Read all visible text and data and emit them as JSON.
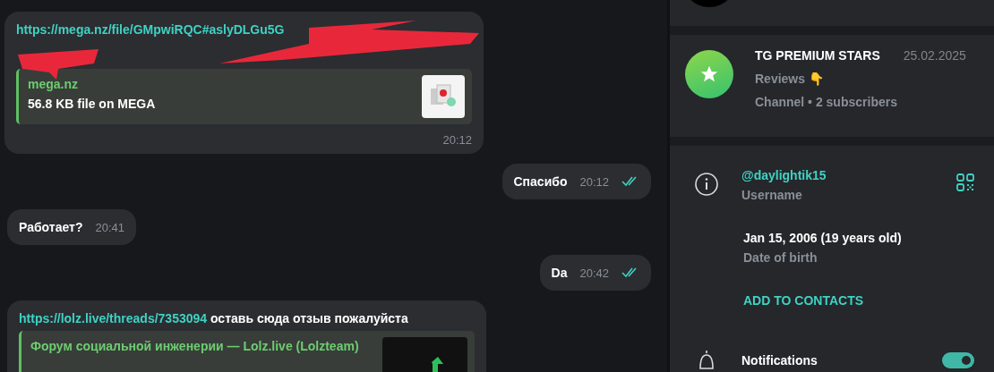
{
  "chat": {
    "messages": [
      {
        "kind": "link",
        "outgoing": false,
        "redacted": true,
        "link": "https://mega.nz/file/GMpwiRQC#aslyDLGu5G",
        "preview": {
          "site": "mega.nz",
          "description": "56.8 KB file on MEGA",
          "thumb": {
            "kind": "file"
          }
        },
        "time": "20:12"
      },
      {
        "kind": "text",
        "outgoing": true,
        "text": "Спасибо",
        "time": "20:12",
        "read": true
      },
      {
        "kind": "text",
        "outgoing": false,
        "text": "Работает?",
        "time": "20:41"
      },
      {
        "kind": "text",
        "outgoing": true,
        "text": "Da",
        "time": "20:42",
        "read": true
      },
      {
        "kind": "link",
        "outgoing": false,
        "redacted": false,
        "link": "https://lolz.live/threads/7353094",
        "text": "оставь сюда отзыв пожалуйста",
        "preview": {
          "site": "Форум социальной инженерии —  Lolz.live (Lolzteam)",
          "thumb": {
            "kind": "chart"
          }
        }
      }
    ]
  },
  "profile": {
    "channel": {
      "name": "TG PREMIUM STARS",
      "date": "25.02.2025",
      "description": "Reviews 👇",
      "meta": "Channel • 2 subscribers"
    },
    "info": {
      "username": "@daylightik15",
      "username_label": "Username",
      "birthday": "Jan 15, 2006 (19 years old)",
      "birthday_label": "Date of birth",
      "add_contact": "ADD TO CONTACTS"
    },
    "notifications": {
      "label": "Notifications",
      "on": true
    }
  }
}
